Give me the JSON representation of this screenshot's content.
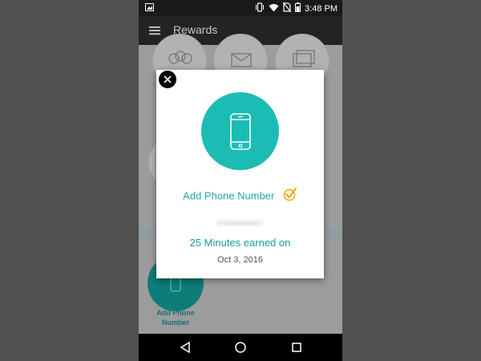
{
  "status_bar": {
    "time": "3:48 PM",
    "icons": [
      "image-icon",
      "vibrate-icon",
      "wifi-icon",
      "no-sim-icon",
      "battery-icon"
    ]
  },
  "app_bar": {
    "title": "Rewards",
    "menu_icon": "hamburger-menu-icon"
  },
  "background": {
    "tile_icons": [
      "contacts-icon",
      "mail-icon",
      "photos-icon"
    ],
    "highlighted_tile_label": "Add Phone Number"
  },
  "modal": {
    "icon": "smartphone-icon",
    "title": "Add Phone Number",
    "check_icon": "checkmark-icon",
    "phone_number": "9780580604627",
    "earned_text": "25 Minutes earned on",
    "date": "Oct 3, 2016",
    "close_icon": "close-icon"
  },
  "nav_bar": {
    "icons": [
      "back-icon",
      "home-icon",
      "recents-icon"
    ]
  },
  "colors": {
    "teal": "#1bbcb4",
    "teal_text": "#26a6a0",
    "check_yellow": "#f0a800",
    "app_bar": "#232323"
  }
}
